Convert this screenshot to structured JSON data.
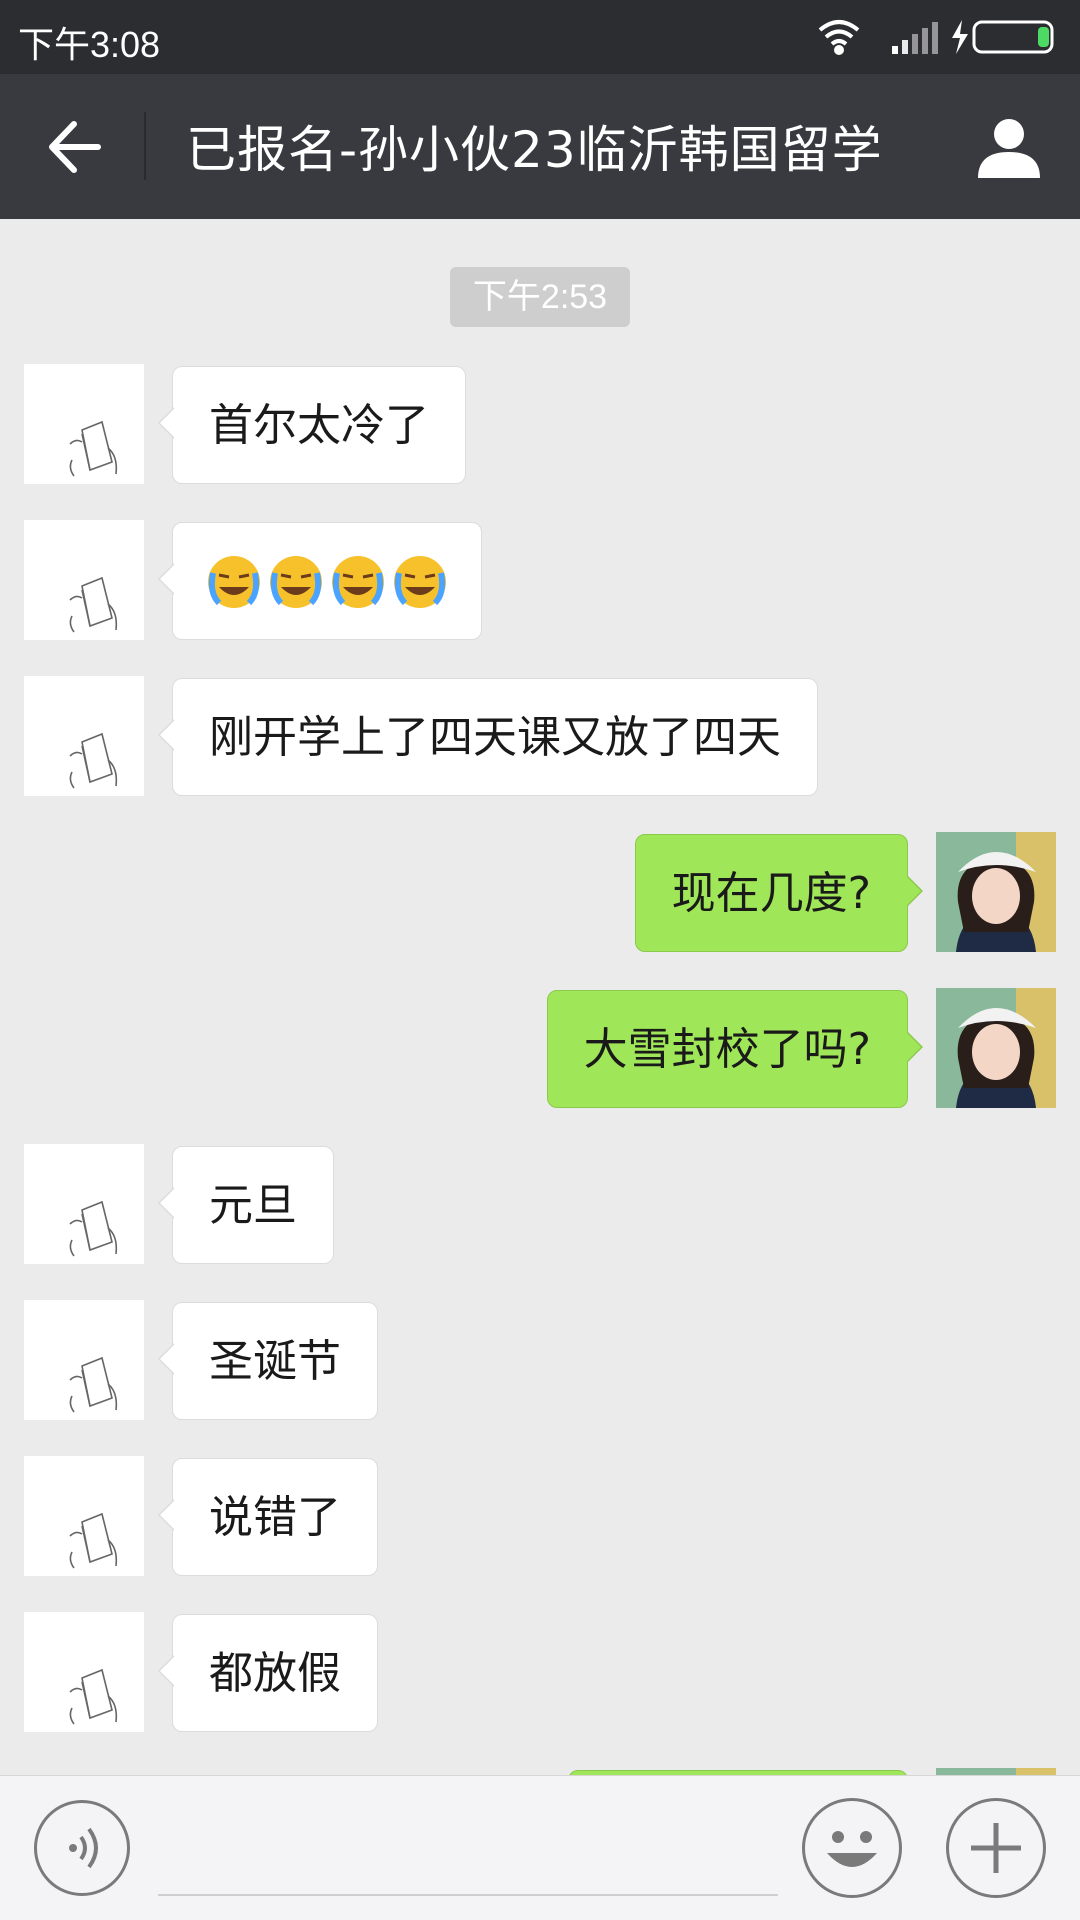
{
  "status_bar": {
    "time": "下午3:08"
  },
  "header": {
    "title": "已报名-孙小伙23临沂韩国留学"
  },
  "timestamp": "下午2:53",
  "messages": [
    {
      "side": "in",
      "text": "首尔太冷了"
    },
    {
      "side": "in",
      "emoji": [
        "crying-face",
        "crying-face",
        "crying-face",
        "crying-face"
      ]
    },
    {
      "side": "in",
      "text": "刚开学上了四天课又放了四天"
    },
    {
      "side": "out",
      "text": "现在几度?"
    },
    {
      "side": "out",
      "text": "大雪封校了吗?"
    },
    {
      "side": "in",
      "text": "元旦"
    },
    {
      "side": "in",
      "text": "圣诞节"
    },
    {
      "side": "in",
      "text": "说错了"
    },
    {
      "side": "in",
      "text": "都放假"
    }
  ],
  "colors": {
    "outgoing": "#9fe658",
    "incoming": "#ffffff",
    "title_bar": "#393a3f",
    "status_bar": "#2c2d30"
  },
  "input": {
    "value": ""
  }
}
